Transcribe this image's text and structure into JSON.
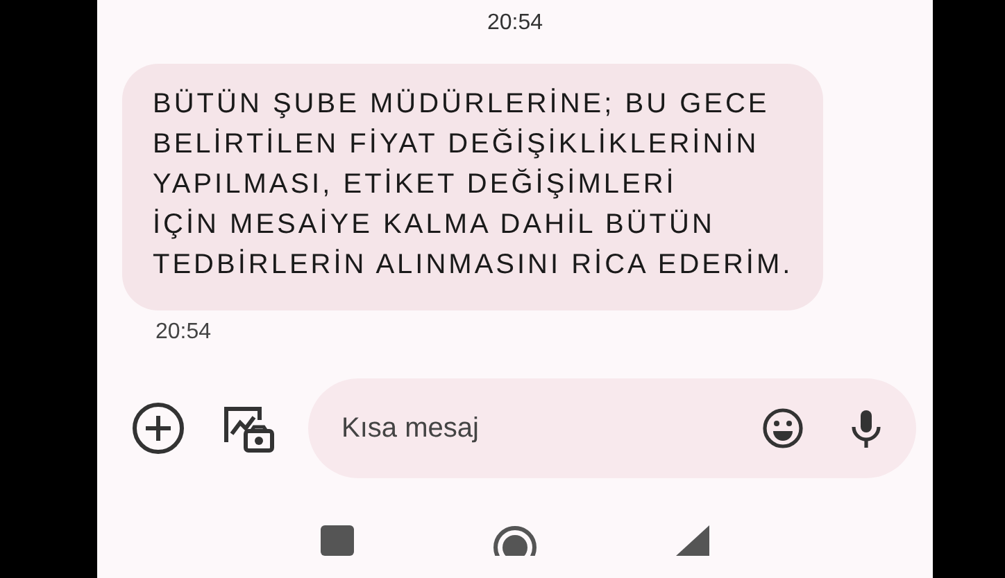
{
  "top_timestamp": "20:54",
  "message": {
    "text": "BÜTÜN ŞUBE MÜDÜRLERİNE; BU GECE\nBELİRTİLEN FİYAT DEĞİŞİKLİKLERİNİN\nYAPILMASI, ETİKET DEĞİŞİMLERİ\nİÇİN MESAİYE KALMA DAHİL BÜTÜN\nTEDBİRLERİN ALINMASINI RİCA EDERİM.",
    "time": "20:54"
  },
  "composer": {
    "placeholder": "Kısa mesaj"
  }
}
